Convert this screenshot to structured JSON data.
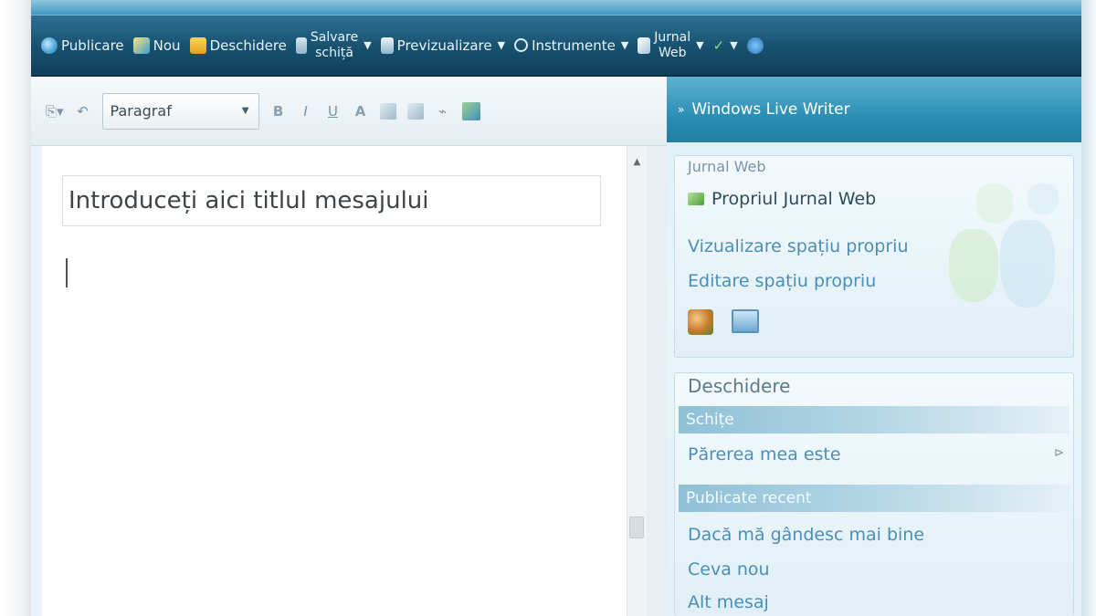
{
  "main_toolbar": {
    "publish": "Publicare",
    "new": "Nou",
    "open": "Deschidere",
    "save_line1": "Salvare",
    "save_line2": "schiță",
    "preview": "Previzualizare",
    "tools": "Instrumente",
    "blog_line1": "Jurnal",
    "blog_line2": "Web"
  },
  "format_toolbar": {
    "paragraph_select": "Paragraf",
    "bold": "B",
    "italic": "I",
    "underline": "U",
    "font_color": "A"
  },
  "editor": {
    "title_placeholder": "Introduceți aici titlul mesajului"
  },
  "sidebar": {
    "header": "Windows Live Writer",
    "blog_panel": {
      "title": "Jurnal Web",
      "blog_name": "Propriul Jurnal Web",
      "view_link": "Vizualizare spațiu propriu",
      "edit_link": "Editare spațiu propriu"
    },
    "open_panel": {
      "title": "Deschidere",
      "drafts_label": "Schițe",
      "drafts": [
        "Părerea mea este"
      ],
      "recent_label": "Publicate recent",
      "recent": [
        "Dacă mă gândesc mai bine",
        "Ceva nou",
        "Alt mesaj"
      ]
    }
  }
}
